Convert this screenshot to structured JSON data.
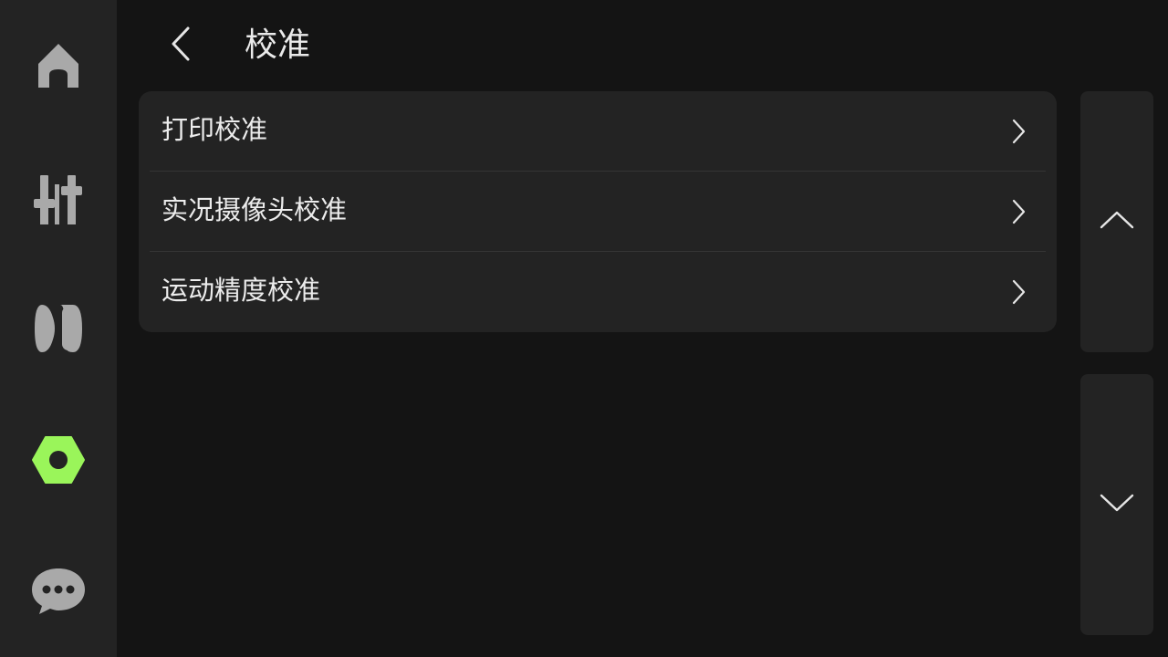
{
  "header": {
    "title": "校准"
  },
  "sidebar": {
    "items": [
      {
        "icon": "home-icon",
        "active": false,
        "color": "#a9a9a9"
      },
      {
        "icon": "sliders-icon",
        "active": false,
        "color": "#a9a9a9"
      },
      {
        "icon": "filament-spool-icon",
        "active": false,
        "color": "#a9a9a9"
      },
      {
        "icon": "settings-nut-icon",
        "active": true,
        "color": "#9af55a"
      },
      {
        "icon": "chat-bubble-icon",
        "active": false,
        "color": "#a9a9a9"
      }
    ]
  },
  "list": {
    "items": [
      {
        "label": "打印校准"
      },
      {
        "label": "实况摄像头校准"
      },
      {
        "label": "运动精度校准"
      }
    ]
  },
  "scroll": {
    "up_icon": "chevron-up-icon",
    "down_icon": "chevron-down-icon"
  },
  "colors": {
    "background": "#141414",
    "panel": "#232323",
    "accent": "#9af55a",
    "icon_inactive": "#a9a9a9",
    "text": "#ececec"
  }
}
